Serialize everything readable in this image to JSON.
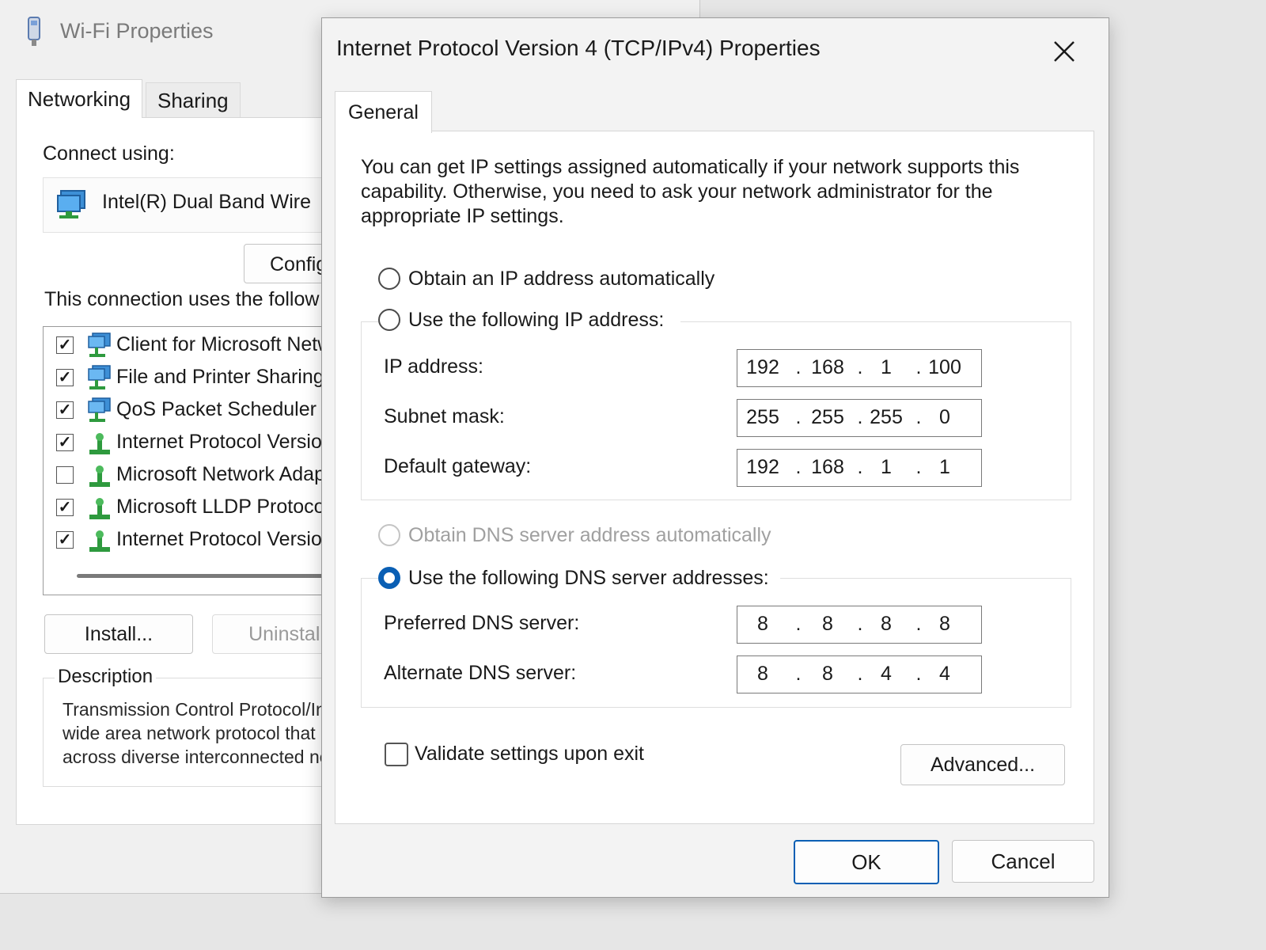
{
  "background_window": {
    "title": "Wi-Fi Properties",
    "tabs": [
      "Networking",
      "Sharing"
    ],
    "connect_using_label": "Connect using:",
    "adapter_name": "Intel(R) Dual Band Wire",
    "configure_label": "Config",
    "components_label": "This connection uses the follow",
    "components": [
      {
        "label": "Client for Microsoft Netw",
        "checked": true,
        "icon": "network-client-icon"
      },
      {
        "label": "File and Printer Sharing f",
        "checked": true,
        "icon": "network-client-icon"
      },
      {
        "label": "QoS Packet Scheduler",
        "checked": true,
        "icon": "network-client-icon"
      },
      {
        "label": "Internet Protocol Version",
        "checked": true,
        "icon": "protocol-icon"
      },
      {
        "label": "Microsoft Network Adapt",
        "checked": false,
        "icon": "protocol-icon"
      },
      {
        "label": "Microsoft LLDP Protocol",
        "checked": true,
        "icon": "protocol-icon"
      },
      {
        "label": "Internet Protocol Version",
        "checked": true,
        "icon": "protocol-icon"
      }
    ],
    "install_label": "Install...",
    "uninstall_label": "Uninstall",
    "description_legend": "Description",
    "description_lines": [
      "Transmission Control Protocol/Int",
      "wide area network protocol that",
      "across diverse interconnected no"
    ]
  },
  "dialog": {
    "title": "Internet Protocol Version 4 (TCP/IPv4) Properties",
    "tab": "General",
    "intro": "You can get IP settings assigned automatically if your network supports this capability. Otherwise, you need to ask your network administrator for the appropriate IP settings.",
    "ip_mode": {
      "auto_label": "Obtain an IP address automatically",
      "manual_label": "Use the following IP address:",
      "selected": "none"
    },
    "ip_fields": {
      "ip_address": {
        "label": "IP address:",
        "octets": [
          "192",
          "168",
          "1",
          "100"
        ]
      },
      "subnet_mask": {
        "label": "Subnet mask:",
        "octets": [
          "255",
          "255",
          "255",
          "0"
        ]
      },
      "default_gateway": {
        "label": "Default gateway:",
        "octets": [
          "192",
          "168",
          "1",
          "1"
        ]
      }
    },
    "dns_mode": {
      "auto_label": "Obtain DNS server address automatically",
      "manual_label": "Use the following DNS server addresses:",
      "selected": "manual"
    },
    "dns_fields": {
      "preferred": {
        "label": "Preferred DNS server:",
        "octets": [
          "8",
          "8",
          "8",
          "8"
        ]
      },
      "alternate": {
        "label": "Alternate DNS server:",
        "octets": [
          "8",
          "8",
          "4",
          "4"
        ]
      }
    },
    "validate_label": "Validate settings upon exit",
    "validate_checked": false,
    "advanced_label": "Advanced...",
    "ok_label": "OK",
    "cancel_label": "Cancel"
  },
  "colors": {
    "accent": "#0a5fb4",
    "disabled_text": "#a0a0a0"
  }
}
